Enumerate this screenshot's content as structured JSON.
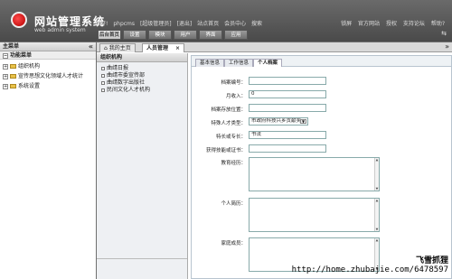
{
  "header": {
    "title": "网站管理系统",
    "subtitle": "web admin system",
    "user_nav": [
      "您好!",
      "phpcms",
      "[超级管理员]",
      "[退出]",
      "站点首页",
      "会员中心",
      "搜索"
    ],
    "top_links": [
      "锁屏",
      "官方网站",
      "授权",
      "支持论坛",
      "帮助?"
    ],
    "tabs": [
      "后台首页",
      "设置",
      "模块",
      "用户",
      "界面",
      "应用"
    ]
  },
  "sidebar": {
    "heading": "主菜单",
    "group": "功能菜单",
    "items": [
      "组织机构",
      "宣传思想文化领域人才统计",
      "系统设置"
    ]
  },
  "main": {
    "page_tabs": [
      "我的主页",
      "人员管理"
    ],
    "org": {
      "heading": "组织机构",
      "items": [
        "曲靖日报",
        "曲靖市委宣传部",
        "曲靖数字出版社",
        "民间文化人才机构"
      ]
    },
    "form": {
      "tabs": [
        "基本信息",
        "工作信息",
        "个人档案"
      ],
      "labels": [
        "档案编号：",
        "月收入：",
        "档案存放位置：",
        "特殊人才类型：",
        "特长或专长：",
        "获得技能或证书：",
        "教育经历：",
        "个人简历：",
        "家庭成员："
      ],
      "values": {
        "monthly_income": "0",
        "talent_type": "市政府科技兴乡贡献奖",
        "specialty": "书法"
      }
    }
  },
  "watermark": {
    "brand": "飞雪抓狸",
    "url": "http://home.zhubajie.com/6478597"
  },
  "colors": {
    "header_bg": "#5a5a5a",
    "panel_bg": "#eef0f3",
    "field_border": "#88aaaa",
    "logo_red": "#c00000"
  }
}
